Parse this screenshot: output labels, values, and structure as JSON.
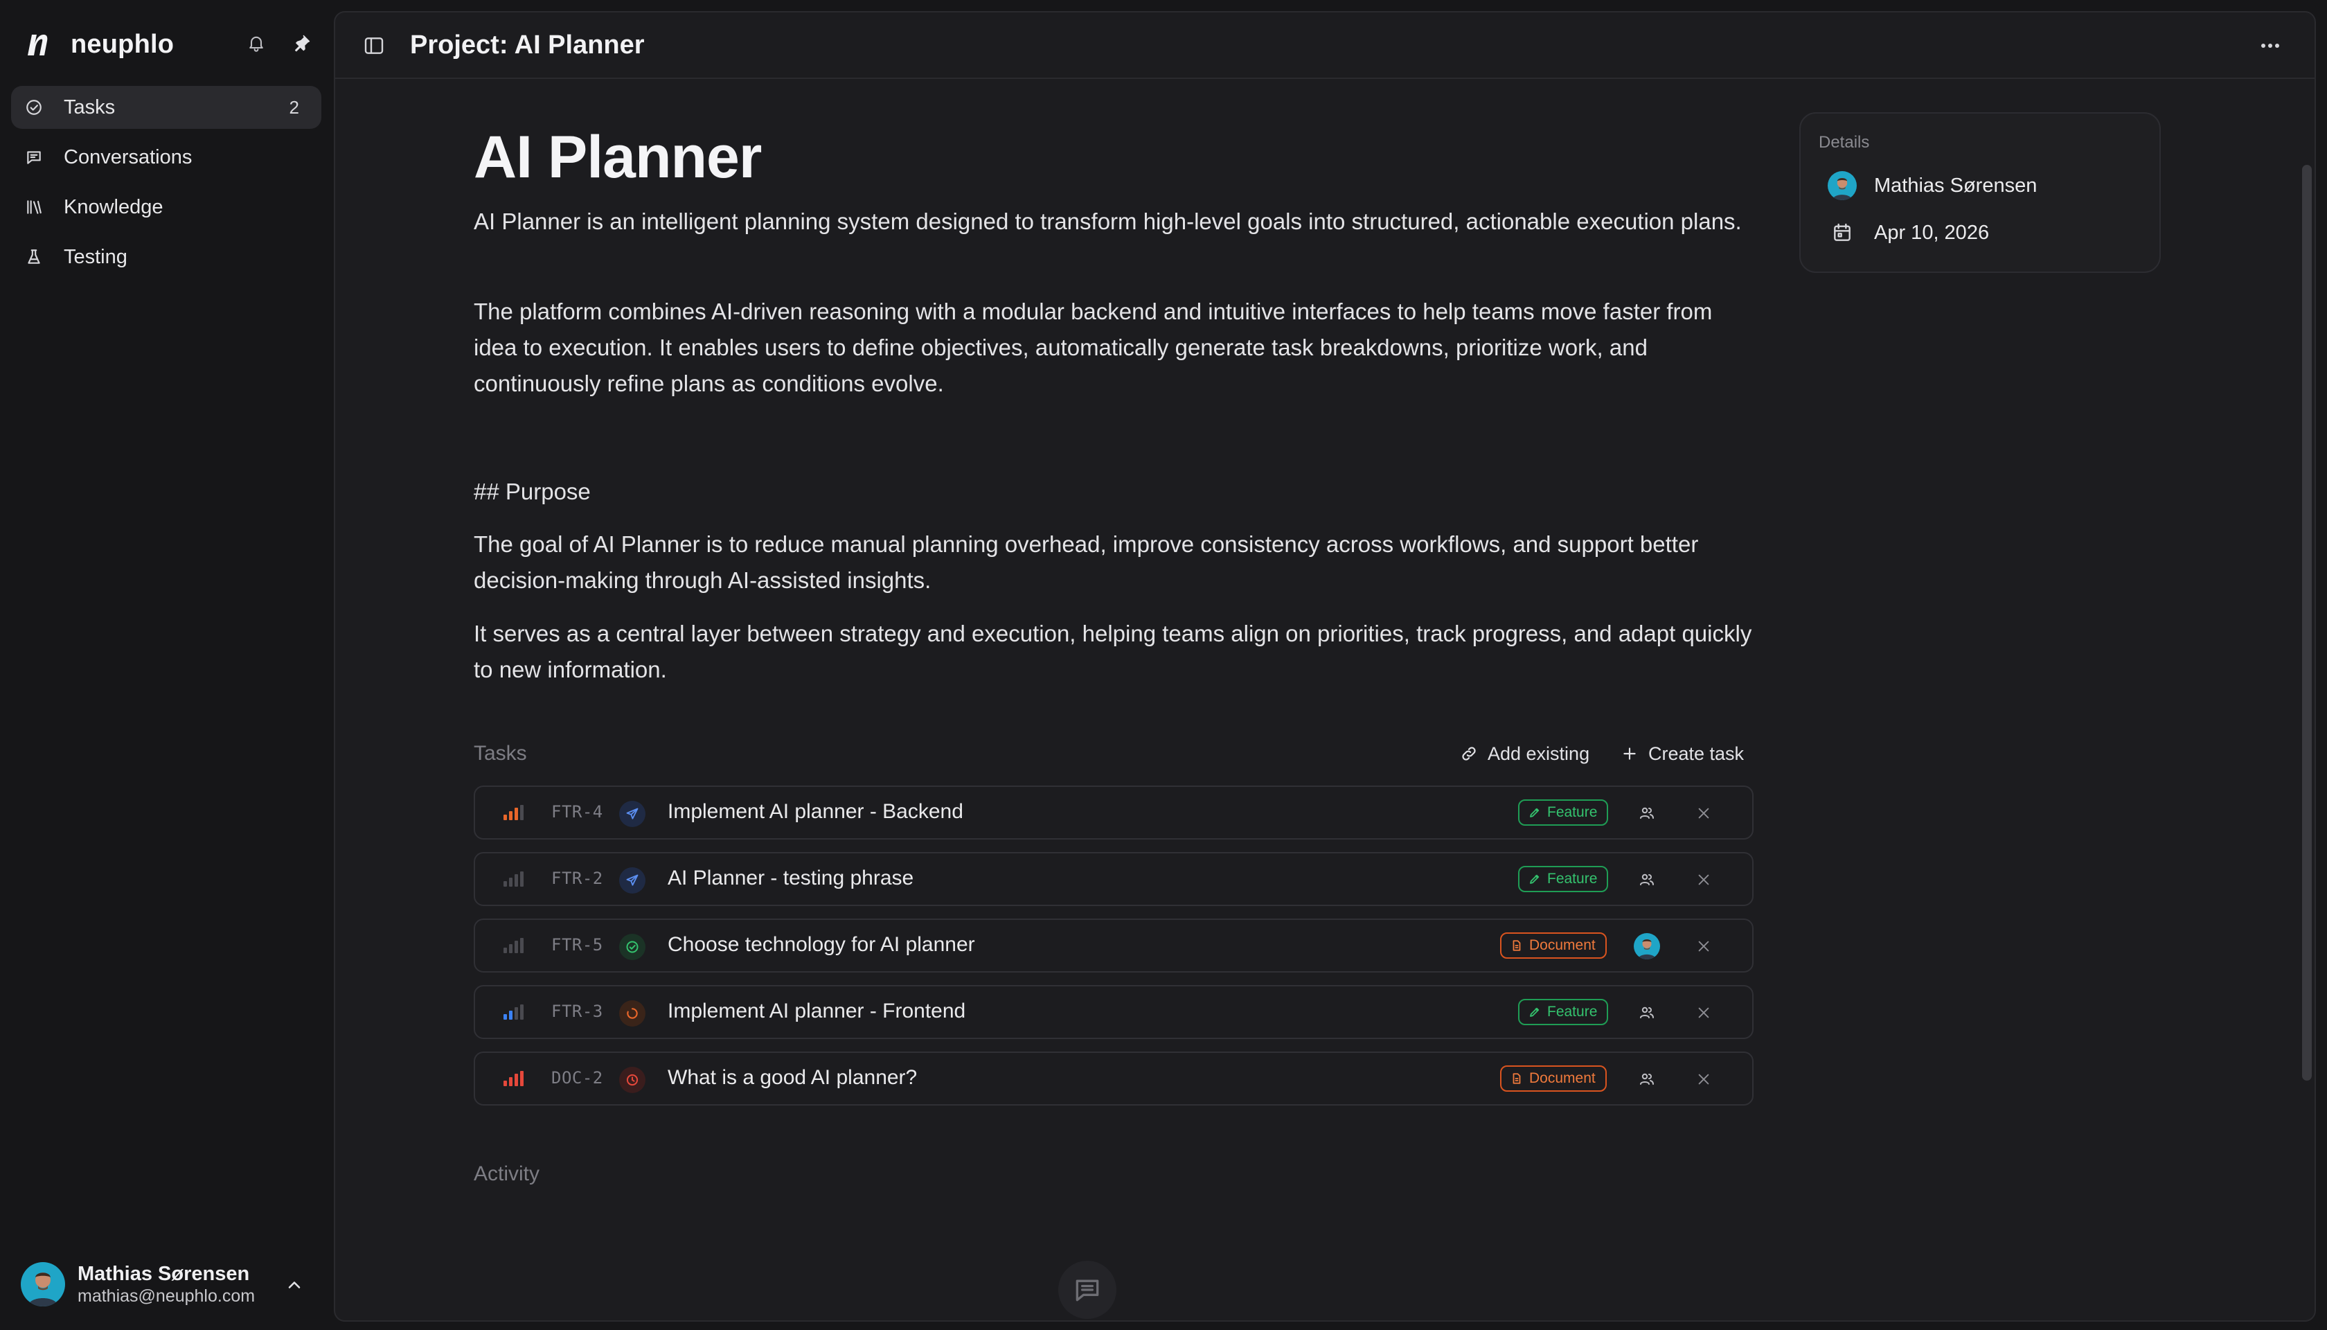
{
  "brand": {
    "name": "neuphlo"
  },
  "sidebar": {
    "items": [
      {
        "label": "Tasks",
        "count": "2",
        "icon": "check-circle-icon"
      },
      {
        "label": "Conversations",
        "icon": "chat-icon"
      },
      {
        "label": "Knowledge",
        "icon": "library-icon"
      },
      {
        "label": "Testing",
        "icon": "flask-icon"
      }
    ]
  },
  "user": {
    "name": "Mathias Sørensen",
    "email": "mathias@neuphlo.com"
  },
  "header": {
    "title": "Project: AI Planner"
  },
  "page": {
    "title": "AI Planner",
    "paragraphs": [
      "AI Planner is an intelligent planning system designed to transform high-level goals into structured, actionable execution plans.",
      "The platform combines AI-driven reasoning with a modular backend and intuitive interfaces to help teams move faster from idea to execution. It enables users to define objectives, automatically generate task breakdowns, prioritize work, and continuously refine plans as conditions evolve.",
      "## Purpose",
      "The goal of AI Planner is to reduce manual planning overhead, improve consistency across workflows, and support better decision-making through AI-assisted insights.",
      "It serves as a central layer between strategy and execution, helping teams align on priorities, track progress, and adapt quickly to new information."
    ]
  },
  "details": {
    "label": "Details",
    "owner": "Mathias Sørensen",
    "date": "Apr 10, 2026"
  },
  "tasks": {
    "label": "Tasks",
    "add_existing": "Add existing",
    "create_task": "Create task",
    "rows": [
      {
        "id": "FTR-4",
        "title": "Implement AI planner - Backend",
        "tag": "Feature",
        "priority": "high",
        "status": "in-review"
      },
      {
        "id": "FTR-2",
        "title": "AI Planner - testing phrase",
        "tag": "Feature",
        "priority": "none",
        "status": "in-review"
      },
      {
        "id": "FTR-5",
        "title": "Choose technology for AI planner",
        "tag": "Document",
        "priority": "none",
        "status": "done"
      },
      {
        "id": "FTR-3",
        "title": "Implement AI planner - Frontend",
        "tag": "Feature",
        "priority": "low",
        "status": "in-progress"
      },
      {
        "id": "DOC-2",
        "title": "What is a good AI planner?",
        "tag": "Document",
        "priority": "urgent",
        "status": "blocked"
      }
    ]
  },
  "activity": {
    "label": "Activity"
  },
  "colors": {
    "feature": "#34c26e",
    "document": "#f07a3c",
    "priority_high": "#e8662a",
    "priority_low": "#3b82f6",
    "priority_urgent": "#e5483b"
  }
}
